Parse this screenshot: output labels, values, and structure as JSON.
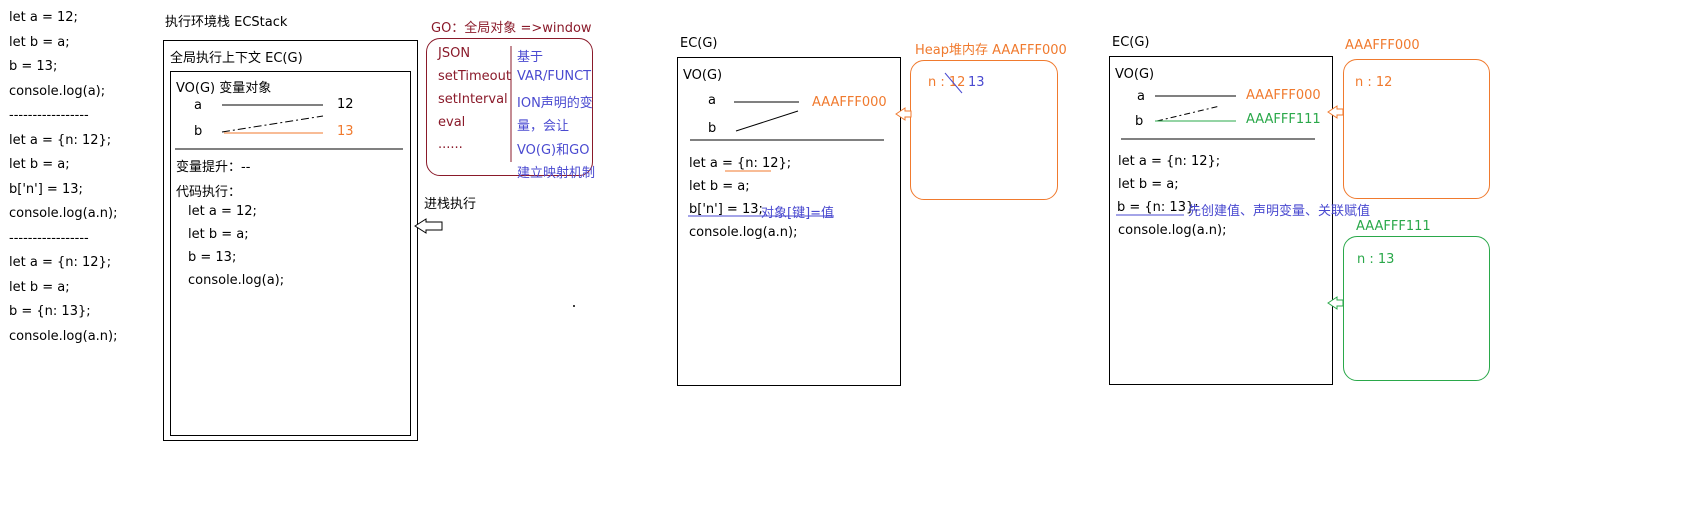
{
  "left_code": [
    "let a = 12;",
    "let b = a;",
    "b = 13;",
    "console.log(a);",
    "-----------------",
    "let a = {n: 12};",
    "let b = a;",
    "b['n'] = 13;",
    "console.log(a.n);",
    "-----------------",
    "let a = {n: 12};",
    "let b = a;",
    "b = {n: 13};",
    "console.log(a.n);"
  ],
  "stack": {
    "title": "执行环境栈  ECStack",
    "ec_title": "全局执行上下文  EC(G)",
    "vo_title": "VO(G)  变量对象",
    "var_a": "a",
    "var_b": "b",
    "val_a": "12",
    "val_b": "13",
    "hoist": "变量提升：--",
    "exec_title": "代码执行：",
    "exec_lines": [
      "let a = 12;",
      "let b = a;",
      "b = 13;",
      "console.log(a);"
    ],
    "push_label": "进栈执行"
  },
  "go": {
    "title": "GO：全局对象 =>window",
    "items": [
      "JSON",
      "setTimeout",
      "setInterval",
      "eval",
      "......"
    ],
    "note_lines": [
      "基于",
      "VAR/FUNCT",
      "ION声明的变",
      "量，会让",
      "VO(G)和GO",
      "建立映射机制"
    ]
  },
  "ex2": {
    "ec_label": "EC(G)",
    "vo_title": "VO(G)",
    "var_a": "a",
    "var_b": "b",
    "address": "AAAFFF000",
    "code_lines": [
      "let a = {n: 12};",
      "let b = a;",
      "b['n'] = 13;",
      "console.log(a.n);"
    ],
    "note": "对象[键]=值",
    "heap_title": "Heap堆内存  AAAFFF000",
    "heap_old": "n : 12",
    "heap_new": "13"
  },
  "ex3": {
    "ec_label": "EC(G)",
    "vo_title": "VO(G)",
    "var_a": "a",
    "var_b": "b",
    "address_a": "AAAFFF000",
    "address_b": "AAAFFF111",
    "code_lines": [
      "let a = {n: 12};",
      "let b = a;",
      "b = {n: 13};",
      "console.log(a.n);"
    ],
    "note": "先创建值、声明变量、关联赋值",
    "heap1_title": "AAAFFF000",
    "heap1_content": "n : 12",
    "heap2_title": "AAAFFF111",
    "heap2_content": "n : 13"
  },
  "colors": {
    "orange": "#f07a2e",
    "blue": "#4a4ad0",
    "green": "#2aa84a",
    "darkred": "#8a1a2a"
  }
}
